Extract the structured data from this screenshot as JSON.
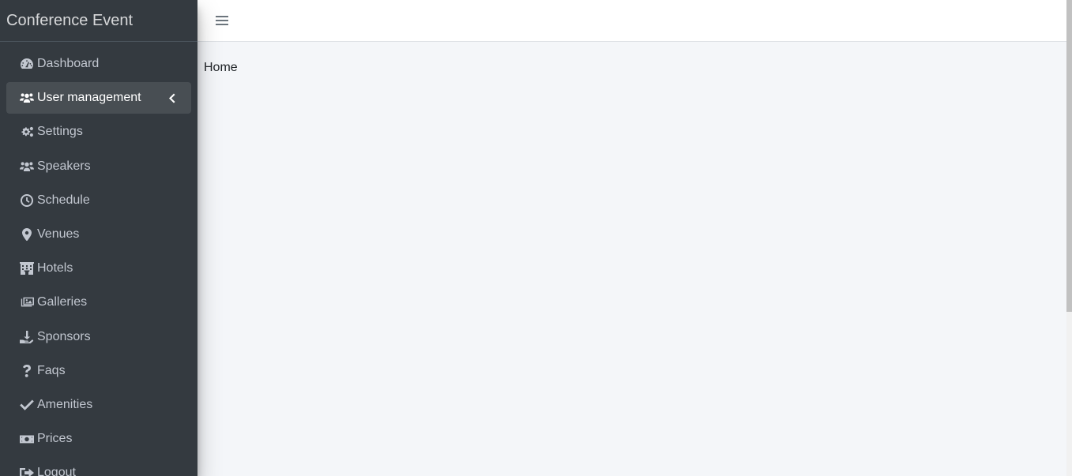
{
  "brand": {
    "title": "Conference Event"
  },
  "sidebar": {
    "items": [
      {
        "label": "Dashboard",
        "icon": "dashboard-icon"
      },
      {
        "label": "User management",
        "icon": "users-icon",
        "active": true
      },
      {
        "label": "Settings",
        "icon": "cogs-icon"
      },
      {
        "label": "Speakers",
        "icon": "users-icon"
      },
      {
        "label": "Schedule",
        "icon": "clock-icon"
      },
      {
        "label": "Venues",
        "icon": "map-marker-icon"
      },
      {
        "label": "Hotels",
        "icon": "hotel-icon"
      },
      {
        "label": "Galleries",
        "icon": "images-icon"
      },
      {
        "label": "Sponsors",
        "icon": "hand-holding-icon"
      },
      {
        "label": "Faqs",
        "icon": "question-icon"
      },
      {
        "label": "Amenities",
        "icon": "check-icon"
      },
      {
        "label": "Prices",
        "icon": "money-bill-icon"
      },
      {
        "label": "Logout",
        "icon": "sign-out-icon"
      }
    ]
  },
  "main": {
    "title": "Home"
  },
  "colors": {
    "sidebar_bg": "#343a40",
    "content_bg": "#f4f6f9",
    "active_item_bg": "rgba(255,255,255,0.1)"
  }
}
